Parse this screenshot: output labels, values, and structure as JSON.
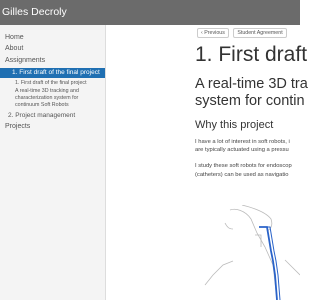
{
  "header": {
    "title": "Gilles Decroly"
  },
  "sidebar": {
    "items": [
      {
        "label": "Home"
      },
      {
        "label": "About"
      },
      {
        "label": "Assignments"
      },
      {
        "label": "1. First draft of the final project"
      },
      {
        "label": "1. First draft of the final project"
      },
      {
        "label": "A real-time 3D tracking and"
      },
      {
        "label": "characterization system for"
      },
      {
        "label": "continuum Soft Robots"
      },
      {
        "label": "2. Project management"
      },
      {
        "label": "Projects"
      }
    ]
  },
  "breadcrumb": {
    "previous_label": "Previous",
    "next_label": "Student Agreement"
  },
  "article": {
    "title": "1. First draft",
    "subtitle_line1": "A real-time 3D tra",
    "subtitle_line2": "system for contin",
    "section_heading": "Why this project",
    "p1_line1": "I have a lot of interest in soft robots, i",
    "p1_line2": "are typically actuated using a pressu",
    "p2_line1": "I study these soft robots for endoscop",
    "p2_line2": "(catheters) can be used as navigatio"
  },
  "icons": {
    "previous": "chevron-left-icon"
  },
  "colors": {
    "topbar": "#6b6b6b",
    "active": "#1f6fb2",
    "figure_line": "#2a63c9"
  }
}
